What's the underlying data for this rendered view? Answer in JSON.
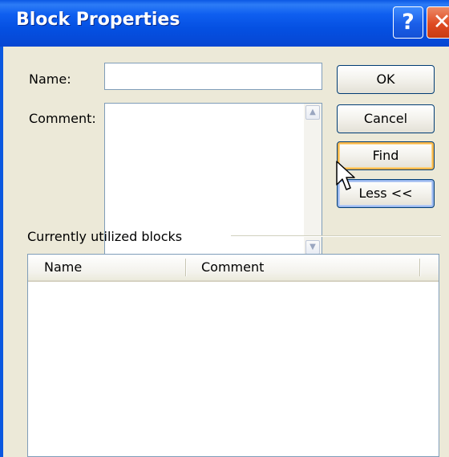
{
  "window": {
    "title": "Block Properties",
    "help_glyph": "?",
    "close_glyph": "✕"
  },
  "form": {
    "name_label": "Name:",
    "name_value": "",
    "comment_label": "Comment:",
    "comment_value": ""
  },
  "buttons": {
    "ok": "OK",
    "cancel": "Cancel",
    "find": "Find",
    "less": "Less <<"
  },
  "blocks_group": {
    "label": "Currently utilized blocks",
    "columns": [
      "Name",
      "Comment"
    ],
    "rows": []
  },
  "icons": {
    "scroll_up": "chevron-up-icon",
    "scroll_down": "chevron-down-icon",
    "cursor": "mouse-pointer-icon"
  }
}
